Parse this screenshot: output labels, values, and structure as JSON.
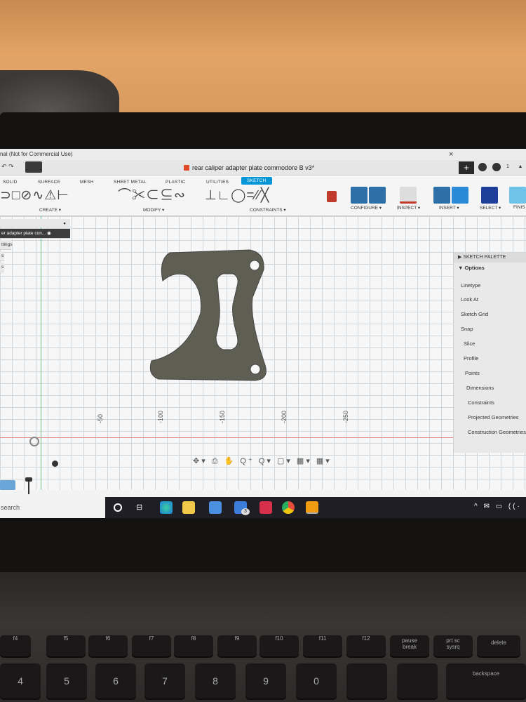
{
  "window": {
    "app_name": "nal (Not for Commercial Use)",
    "doc_title": "rear caliper adapter plate commodore B v3*",
    "close": "×",
    "tab_plus": "+"
  },
  "toolbar": {
    "tabs": [
      "SOLID",
      "SURFACE",
      "MESH",
      "SHEET METAL",
      "PLASTIC",
      "UTILITIES",
      "SKETCH"
    ],
    "active_tab": "SKETCH",
    "groups": [
      "CREATE ▾",
      "MODIFY ▾",
      "CONSTRAINTS ▾",
      "CONFIGURE ▾",
      "INSPECT ▾",
      "INSERT ▾",
      "SELECT ▾",
      "FINIS"
    ]
  },
  "browser": {
    "component": "er adapter plate con...",
    "items": [
      "ttings",
      "s",
      "s",
      "",
      "s"
    ]
  },
  "palette": {
    "header": "▶ SKETCH PALETTE",
    "section": "▼ Options",
    "options": [
      "Linetype",
      "Look At",
      "Sketch Grid",
      "Snap",
      "Slice",
      "Profile",
      "Points",
      "Dimensions",
      "Constraints",
      "Projected Geometries",
      "Construction Geometries"
    ]
  },
  "ruler": [
    "-50",
    "-100",
    "-150",
    "-200",
    "-250"
  ],
  "nav": "✥▾ ⎙ ✋ Q⁺ Q▾ ▢▾ ▦▾ ▦▾",
  "taskbar": {
    "search": "search",
    "tray": "^ ✉ ▭ ((·",
    "badge": "3"
  },
  "keys": {
    "fn": [
      "f4",
      "f5",
      "f6",
      "f7",
      "f8",
      "f9",
      "f10",
      "f11",
      "f12"
    ],
    "pause": "pause",
    "pause_sub": "break",
    "prt": "prt sc",
    "prt_sub": "sysrq",
    "delete": "delete",
    "numbers": [
      "4",
      "5",
      "6",
      "7",
      "8",
      "9",
      "0"
    ],
    "backspace": "backspace"
  },
  "colors": {
    "accent": "#0696d7",
    "part_fill": "#5e5e52",
    "x_axis": "#e08080",
    "y_axis": "#6cc08a"
  }
}
